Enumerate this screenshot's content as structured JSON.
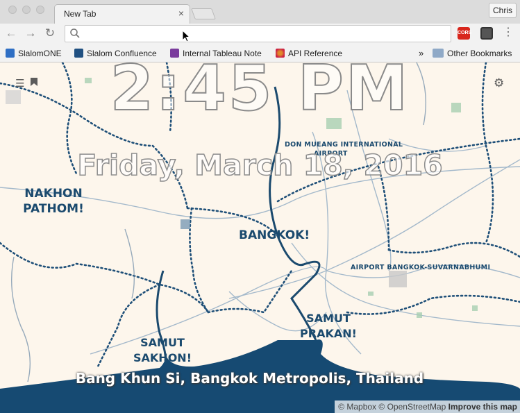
{
  "browser": {
    "tab_title": "New Tab",
    "tab_close": "×",
    "profile": "Chris",
    "omnibox_value": "",
    "ext_cors": "CORS",
    "bookmarks": [
      {
        "label": "SlalomONE",
        "icon": "slalom-icon",
        "color": "#2f6fc4"
      },
      {
        "label": "Slalom Confluence",
        "icon": "confluence-icon",
        "color": "#205081"
      },
      {
        "label": "Internal Tableau Note",
        "icon": "onenote-icon",
        "color": "#7a3b9c"
      },
      {
        "label": "API Reference",
        "icon": "api-dots-icon",
        "color": "#e08a2a"
      }
    ],
    "overflow_chevron": "»",
    "other_bookmarks": "Other Bookmarks"
  },
  "page": {
    "time": "2:45 PM",
    "date": "Friday, March 18, 2016",
    "location": "Bang Khun Si, Bangkok Metropolis, Thailand",
    "places": {
      "nakhon_pathom": "NAKHON PATHOM!",
      "bangkok": "BANGKOK!",
      "samut_prakan": "SAMUT PRAKAN!",
      "samut_sakhon": "SAMUT SAKHON!",
      "don_mueang": "DON MUEANG INTERNATIONAL",
      "don_mueang_2": "AIRPORT",
      "suvarnabhumi": "AIRPORT BANGKOK-SUVARNABHUMI"
    },
    "attribution": {
      "mapbox": "© Mapbox",
      "osm": "© OpenStreetMap",
      "improve": "Improve this map"
    }
  },
  "colors": {
    "map_bg": "#fdf6ec",
    "water": "#164a72",
    "boundary": "#1e4f78",
    "road": "#8aa5bd",
    "park": "#a8cfb2"
  }
}
